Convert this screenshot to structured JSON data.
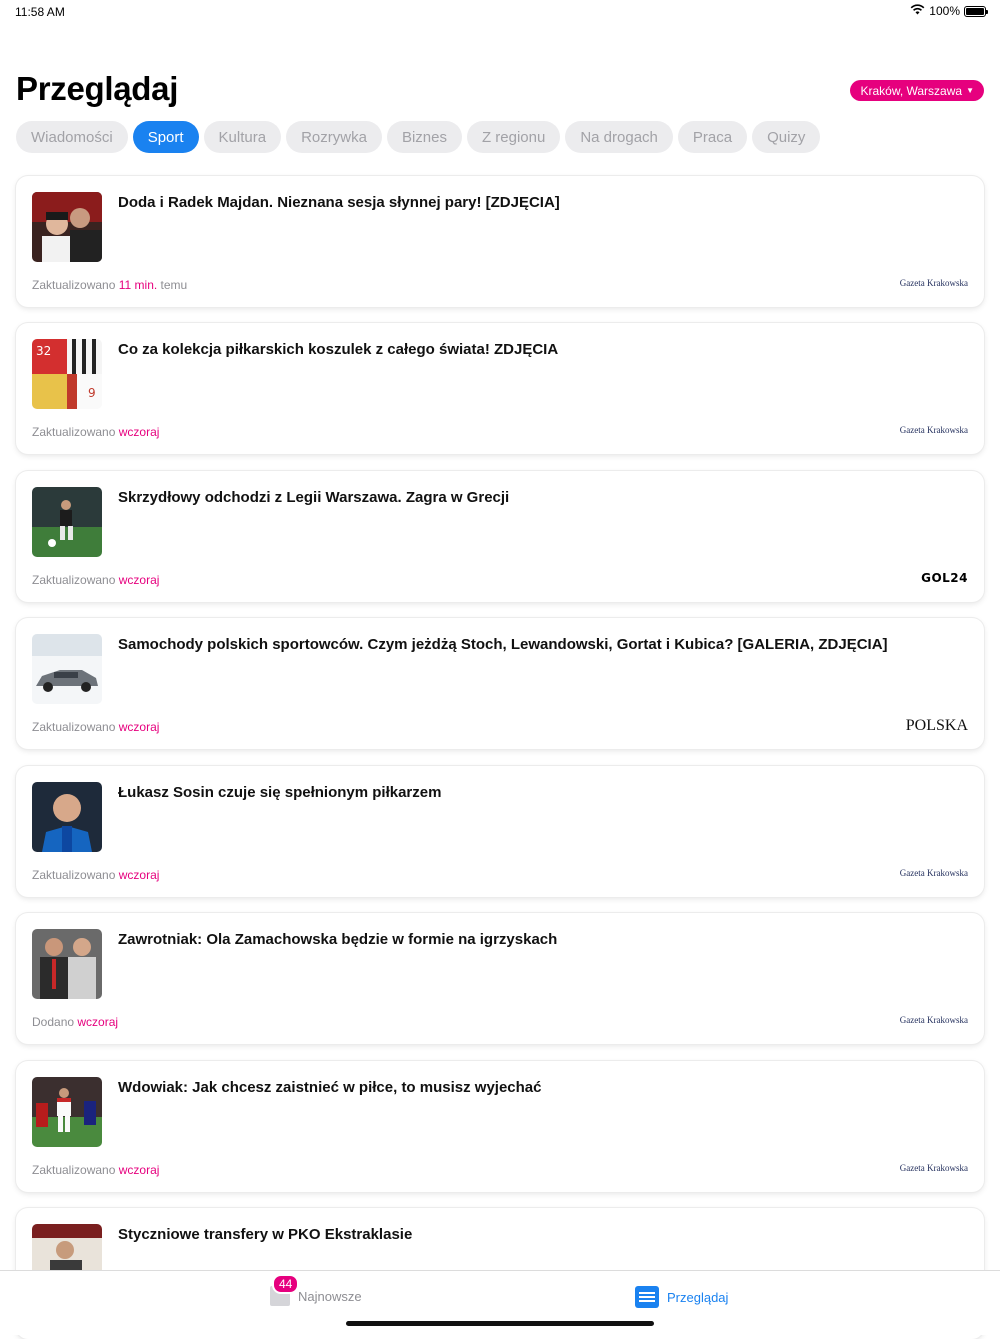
{
  "status": {
    "time": "11:58 AM",
    "battery": "100%"
  },
  "header": {
    "title": "Przeglądaj",
    "city": "Kraków, Warszawa"
  },
  "tabs": [
    "Wiadomości",
    "Sport",
    "Kultura",
    "Rozrywka",
    "Biznes",
    "Z regionu",
    "Na drogach",
    "Praca",
    "Quizy"
  ],
  "active_tab": "Sport",
  "articles": [
    {
      "title": "Doda i Radek Majdan. Nieznana sesja słynnej pary! [ZDJĘCIA]",
      "meta_prefix": "Zaktualizowano",
      "time": "11 min.",
      "meta_suffix": "temu",
      "source": "Gazeta Krakowska"
    },
    {
      "title": "Co za kolekcja piłkarskich koszulek z całego świata! ZDJĘCIA",
      "meta_prefix": "Zaktualizowano",
      "time": "wczoraj",
      "meta_suffix": "",
      "source": "Gazeta Krakowska"
    },
    {
      "title": "Skrzydłowy odchodzi z Legii Warszawa. Zagra w Grecji",
      "meta_prefix": "Zaktualizowano",
      "time": "wczoraj",
      "meta_suffix": "",
      "source": "GOL24"
    },
    {
      "title": "Samochody polskich sportowców. Czym jeżdżą Stoch, Lewandowski, Gortat i Kubica? [GALERIA, ZDJĘCIA]",
      "meta_prefix": "Zaktualizowano",
      "time": "wczoraj",
      "meta_suffix": "",
      "source": "POLSKA"
    },
    {
      "title": "Łukasz Sosin czuje się spełnionym piłkarzem",
      "meta_prefix": "Zaktualizowano",
      "time": "wczoraj",
      "meta_suffix": "",
      "source": "Gazeta Krakowska"
    },
    {
      "title": "Zawrotniak: Ola Zamachowska będzie w formie na igrzyskach",
      "meta_prefix": "Dodano",
      "time": "wczoraj",
      "meta_suffix": "",
      "source": "Gazeta Krakowska"
    },
    {
      "title": "Wdowiak: Jak chcesz zaistnieć w piłce, to musisz wyjechać",
      "meta_prefix": "Zaktualizowano",
      "time": "wczoraj",
      "meta_suffix": "",
      "source": "Gazeta Krakowska"
    },
    {
      "title": "Styczniowe transfery w PKO Ekstraklasie",
      "meta_prefix": "",
      "time": "",
      "meta_suffix": "",
      "source": ""
    }
  ],
  "bottom_nav": {
    "latest_label": "Najnowsze",
    "latest_badge": "44",
    "browse_label": "Przeglądaj"
  },
  "colors": {
    "accent": "#e6007e",
    "active_tab": "#1a82f0"
  }
}
